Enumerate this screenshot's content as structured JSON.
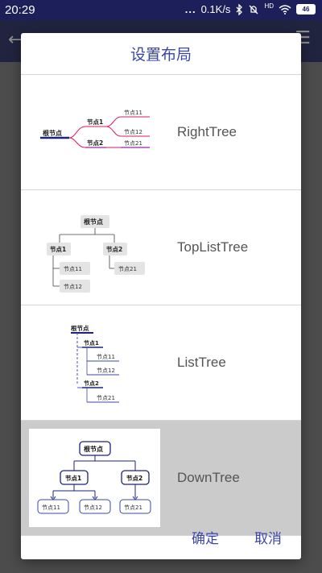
{
  "status_bar": {
    "time": "20:29",
    "dots": "...",
    "network_speed": "0.1K/s",
    "icons": [
      "bluetooth-icon",
      "mute-icon",
      "hd-signal-icon",
      "wifi-icon",
      "battery-icon"
    ],
    "hd_label": "HD",
    "battery_level": "46"
  },
  "dialog": {
    "title": "设置布局",
    "options": [
      {
        "label": "RightTree",
        "selected": false,
        "preview": {
          "root": "根节点",
          "child1": "节点1",
          "child2": "节点2",
          "leaf11": "节点11",
          "leaf12": "节点12",
          "leaf21": "节点21"
        }
      },
      {
        "label": "TopListTree",
        "selected": false,
        "preview": {
          "root": "根节点",
          "child1": "节点1",
          "child2": "节点2",
          "leaf11": "节点11",
          "leaf12": "节点12",
          "leaf21": "节点21"
        }
      },
      {
        "label": "ListTree",
        "selected": false,
        "preview": {
          "root": "根节点",
          "child1": "节点1",
          "child2": "节点2",
          "leaf11": "节点11",
          "leaf12": "节点12",
          "leaf21": "节点21"
        }
      },
      {
        "label": "DownTree",
        "selected": true,
        "preview": {
          "root": "根节点",
          "child1": "节点1",
          "child2": "节点2",
          "leaf11": "节点11",
          "leaf12": "节点12",
          "leaf21": "节点21"
        }
      }
    ],
    "ok_label": "确定",
    "cancel_label": "取消"
  },
  "colors": {
    "accent": "#3a46a8",
    "status_bar": "#1c1f5a",
    "app_bar": "#3d4374",
    "selected_row": "#cbcbcb",
    "tree_navy": "#1a237e",
    "tree_pink": "#d81b60",
    "tree_blue": "#3949ab"
  }
}
